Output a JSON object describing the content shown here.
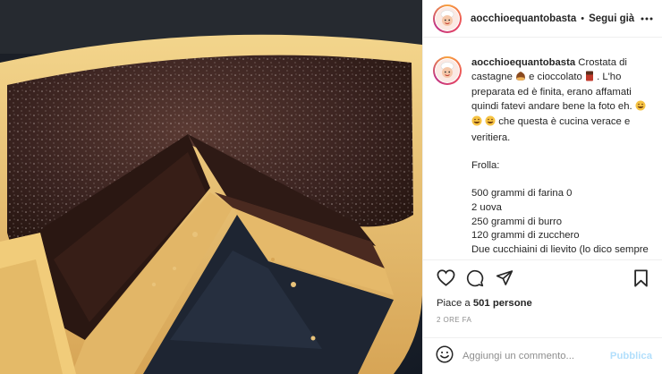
{
  "header": {
    "username": "aocchioequantobasta",
    "separator": "•",
    "follow_label": "Segui già"
  },
  "caption": {
    "username": "aocchioequantobasta",
    "text_1": "Crostata di castagne",
    "text_2": "e cioccolato",
    "text_3": ". L'ho preparata ed è finita, erano affamati quindi fatevi andare bene la foto eh.",
    "text_4": "che questa è cucina verace e veritiera.",
    "frolla_title": "Frolla:",
    "ingredients": [
      "500 grammi di farina 0",
      "2 uova",
      "250 grammi di burro",
      "120 grammi di zucchero",
      "Due cucchiaini di lievito (lo dico sempre facoltativo!)"
    ]
  },
  "icons": {
    "more": "more-horizontal-icon",
    "like": "heart-icon",
    "comment": "comment-icon",
    "share": "paper-plane-icon",
    "save": "bookmark-icon",
    "emoji": "emoji-smile-icon",
    "chestnut": "chestnut-emoji",
    "chocolate": "chocolate-bar-emoji",
    "laugh": "rolling-laughing-emoji"
  },
  "likes": {
    "prefix": "Piace a",
    "count": "501",
    "suffix": "persone"
  },
  "time_ago": "2 ORE FA",
  "comment": {
    "placeholder": "Aggiungi un commento...",
    "publish_label": "Pubblica"
  },
  "colors": {
    "text": "#262626",
    "muted": "#8e8e8e",
    "publish_disabled": "#b2dffc",
    "border": "#efefef"
  }
}
